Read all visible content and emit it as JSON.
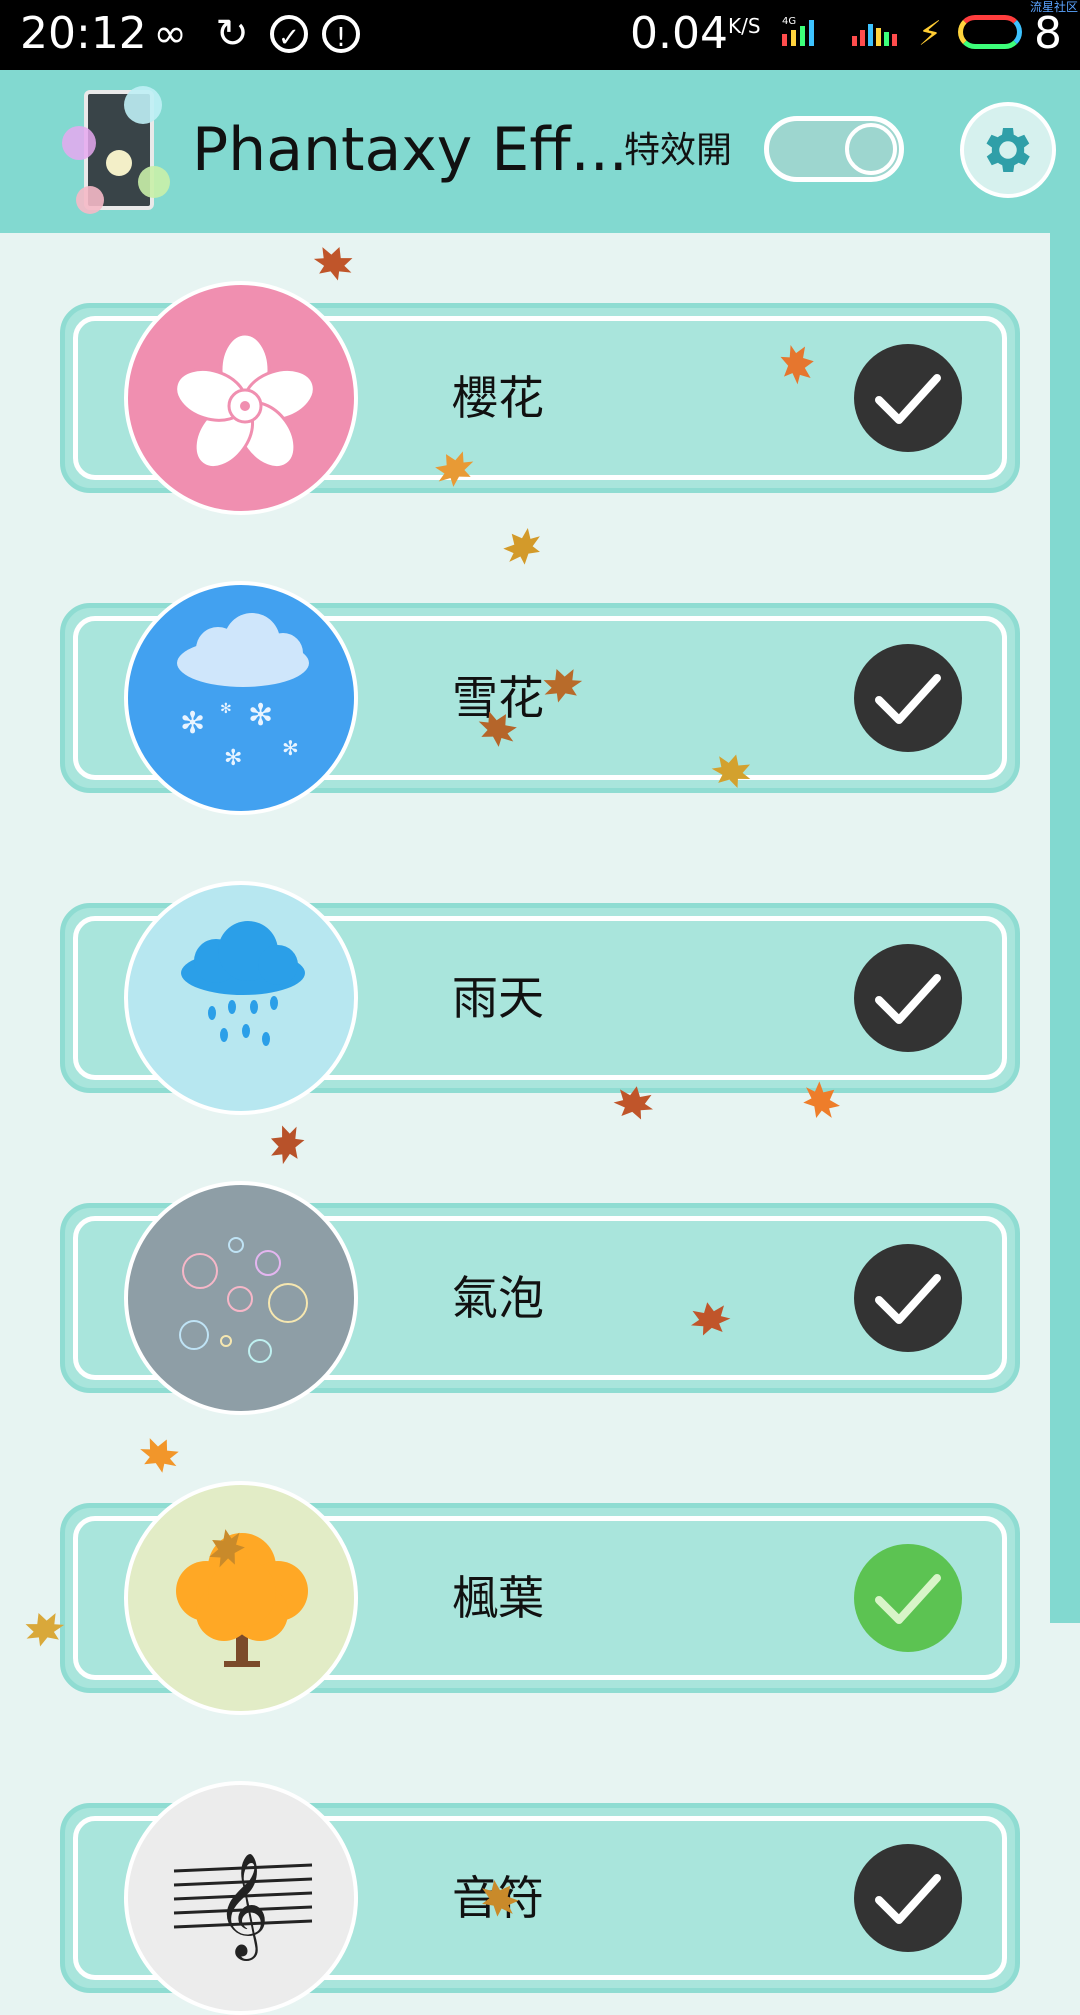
{
  "status_bar": {
    "time": "20:12",
    "net_speed": "0.04",
    "net_unit": "K/S",
    "network_type": "4G",
    "battery": "8",
    "corner_text": "流星社区",
    "icons": [
      "infinity-icon",
      "sync-icon",
      "check-circle-icon",
      "alert-icon"
    ]
  },
  "header": {
    "title": "Phantaxy Eff...",
    "effect_label": "特效開",
    "toggle_on": true
  },
  "effects": [
    {
      "label": "櫻花",
      "icon": "cherry-blossom-icon",
      "selected": false,
      "icon_bg": "#f08fb0"
    },
    {
      "label": "雪花",
      "icon": "snow-cloud-icon",
      "selected": false,
      "icon_bg": "#42a1f0"
    },
    {
      "label": "雨天",
      "icon": "rain-cloud-icon",
      "selected": false,
      "icon_bg": "#b7e7f0"
    },
    {
      "label": "氣泡",
      "icon": "bubbles-icon",
      "selected": false,
      "icon_bg": "#8e9ea6"
    },
    {
      "label": "楓葉",
      "icon": "maple-tree-icon",
      "selected": true,
      "icon_bg": "#e2ecc6"
    },
    {
      "label": "音符",
      "icon": "music-staff-icon",
      "selected": false,
      "icon_bg": "#ececec"
    }
  ],
  "colors": {
    "header": "#82d9d0",
    "card": "#a9e5dc",
    "check_dark": "#333333",
    "check_selected": "#5cc352"
  }
}
